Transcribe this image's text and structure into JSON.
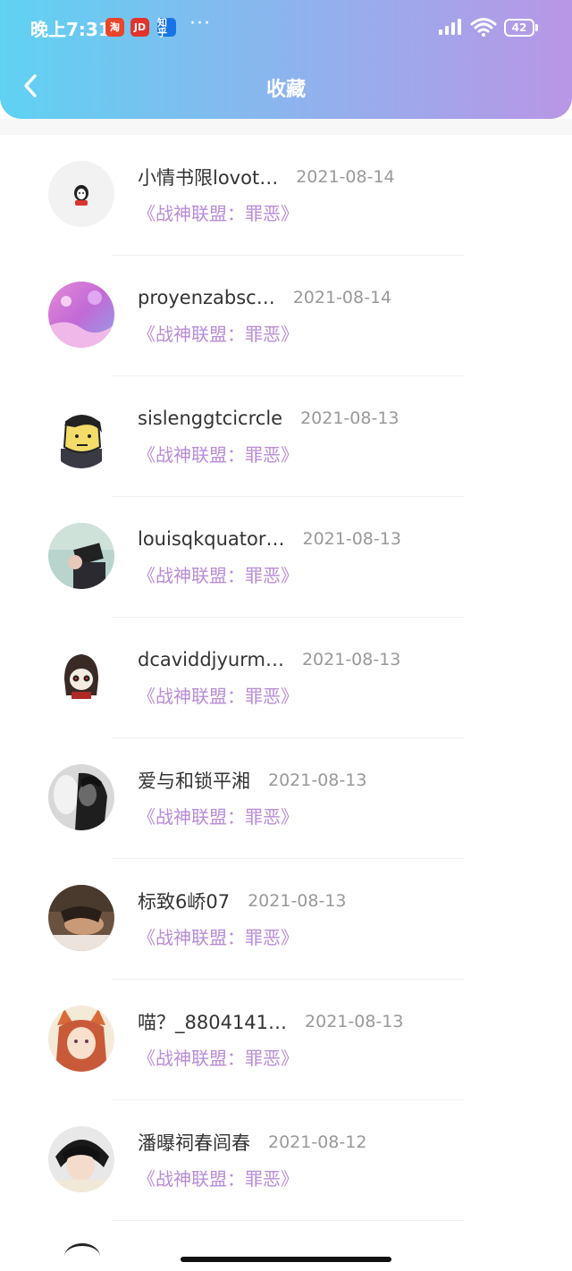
{
  "status_bar": {
    "time": "晚上7:31",
    "apps": [
      {
        "label": "淘"
      },
      {
        "label": "JD"
      },
      {
        "label": "知乎"
      }
    ],
    "more": "···",
    "battery": "42"
  },
  "header": {
    "title": "收藏"
  },
  "items": [
    {
      "username": "小情书限lovot…",
      "date": "2021-08-14",
      "collection": "《战神联盟：罪恶》"
    },
    {
      "username": "proyenzabsc…",
      "date": "2021-08-14",
      "collection": "《战神联盟：罪恶》"
    },
    {
      "username": "sislenggtcicrcle",
      "date": "2021-08-13",
      "collection": "《战神联盟：罪恶》"
    },
    {
      "username": "louisqkquator…",
      "date": "2021-08-13",
      "collection": "《战神联盟：罪恶》"
    },
    {
      "username": "dcaviddjyurm…",
      "date": "2021-08-13",
      "collection": "《战神联盟：罪恶》"
    },
    {
      "username": "爱与和锁平湘",
      "date": "2021-08-13",
      "collection": "《战神联盟：罪恶》"
    },
    {
      "username": "标致6峤07",
      "date": "2021-08-13",
      "collection": "《战神联盟：罪恶》"
    },
    {
      "username": "喵？_8804141…",
      "date": "2021-08-13",
      "collection": "《战神联盟：罪恶》"
    },
    {
      "username": "潘曝祠春闾春",
      "date": "2021-08-12",
      "collection": "《战神联盟：罪恶》"
    }
  ],
  "colors": {
    "header_gradient_start": "#5fd2f2",
    "header_gradient_end": "#b996e6",
    "collection_title": "#b98cd8",
    "date": "#999999"
  }
}
